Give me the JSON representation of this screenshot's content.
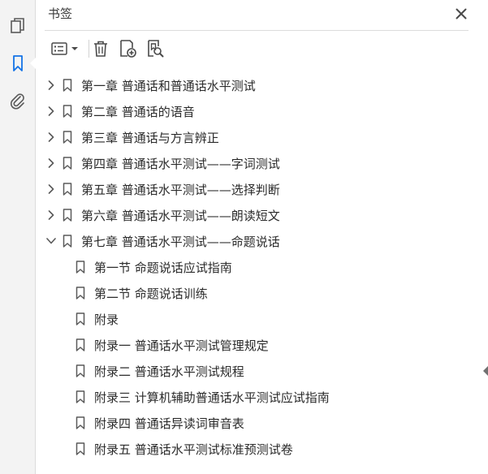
{
  "panel": {
    "title": "书签"
  },
  "toolbar": {
    "items": [
      "options-menu",
      "delete",
      "new-bookmark",
      "find-bookmark"
    ]
  },
  "bookmarks": [
    {
      "label": "第一章  普通话和普通话水平测试",
      "level": 1,
      "expandable": true,
      "expanded": false
    },
    {
      "label": "第二章  普通话的语音",
      "level": 1,
      "expandable": true,
      "expanded": false
    },
    {
      "label": "第三章  普通话与方言辨正",
      "level": 1,
      "expandable": true,
      "expanded": false
    },
    {
      "label": "第四章  普通话水平测试——字词测试",
      "level": 1,
      "expandable": true,
      "expanded": false
    },
    {
      "label": "第五章  普通话水平测试——选择判断",
      "level": 1,
      "expandable": true,
      "expanded": false
    },
    {
      "label": "第六章  普通话水平测试——朗读短文",
      "level": 1,
      "expandable": true,
      "expanded": false
    },
    {
      "label": "第七章  普通话水平测试——命题说话",
      "level": 1,
      "expandable": true,
      "expanded": true
    },
    {
      "label": "第一节  命题说话应试指南",
      "level": 2,
      "expandable": false
    },
    {
      "label": "第二节  命题说话训练",
      "level": 2,
      "expandable": false
    },
    {
      "label": "附录",
      "level": 2,
      "expandable": false
    },
    {
      "label": "附录一  普通话水平测试管理规定",
      "level": 2,
      "expandable": false
    },
    {
      "label": "附录二  普通话水平测试规程",
      "level": 2,
      "expandable": false
    },
    {
      "label": "附录三  计算机辅助普通话水平测试应试指南",
      "level": 2,
      "expandable": false
    },
    {
      "label": "附录四  普通话异读词审音表",
      "level": 2,
      "expandable": false
    },
    {
      "label": "附录五  普通话水平测试标准预测试卷",
      "level": 2,
      "expandable": false
    }
  ],
  "colors": {
    "icon": "#4a4a4a",
    "accent": "#1473e6",
    "rail": "#f3f3f3"
  }
}
